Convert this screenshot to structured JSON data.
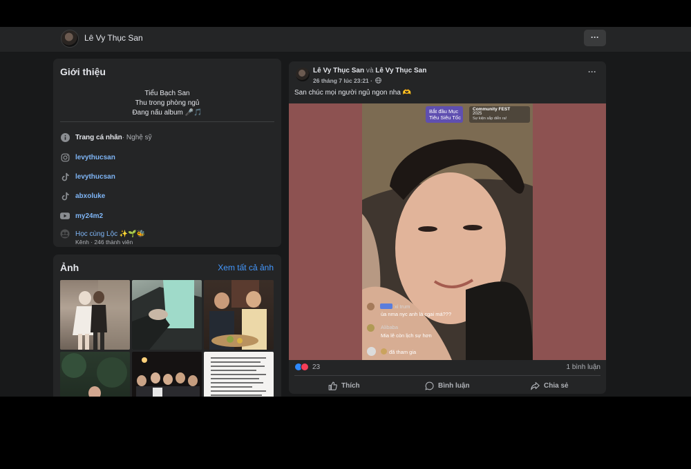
{
  "header": {
    "profile_name": "Lê Vy Thục San",
    "more_label": "···"
  },
  "intro": {
    "title": "Giới thiệu",
    "bio": [
      "Tiểu Bạch San",
      "Thu trong phòng ngủ",
      "Đang nấu album 🎤🎵"
    ],
    "page_label": "Trang cá nhân",
    "page_category": " · Nghệ sỹ",
    "links": [
      {
        "icon": "instagram-icon",
        "text": "levythucsan"
      },
      {
        "icon": "tiktok-icon",
        "text": "levythucsan"
      },
      {
        "icon": "tiktok-icon",
        "text": "abxoluke"
      },
      {
        "icon": "youtube-icon",
        "text": "my24m2"
      }
    ],
    "group": {
      "name": "Học cùng Lộc ✨🌱🐝",
      "sub": "Kênh · 246 thành viên"
    }
  },
  "photos": {
    "title": "Ảnh",
    "see_all": "Xem tất cả ảnh"
  },
  "post": {
    "author1": "Lê Vy Thục San",
    "and": " và ",
    "author2": "Lê Vy Thục San",
    "meta": "26 tháng 7 lúc 23:21 ·",
    "more_label": "···",
    "caption": "San chúc mọi người ngủ ngon nha 🫶",
    "live": {
      "badge1_line1": "Bắt đầu Mục",
      "badge1_line2": "Tiêu Siêu Tốc",
      "badge2_line1": "Community FEST",
      "badge2_line2": "2025",
      "badge2_line3": "Sự kiện sắp diễn ra!",
      "comment1_user": "xỉ trum",
      "comment1_text": "ủa nma nyc anh là cgai má???",
      "comment2_user": "Alibaba",
      "comment2_text": "Mia lê còn lịch sự hơn",
      "join_text": "đã tham gia"
    },
    "reaction_count": "23",
    "comments_count": "1 bình luận",
    "actions": {
      "like": "Thích",
      "comment": "Bình luận",
      "share": "Chia sẻ"
    }
  },
  "colors": {
    "accent_link": "#4599ff",
    "card_bg": "#242526",
    "page_bg": "#18191a",
    "media_bg": "#8d5251"
  }
}
